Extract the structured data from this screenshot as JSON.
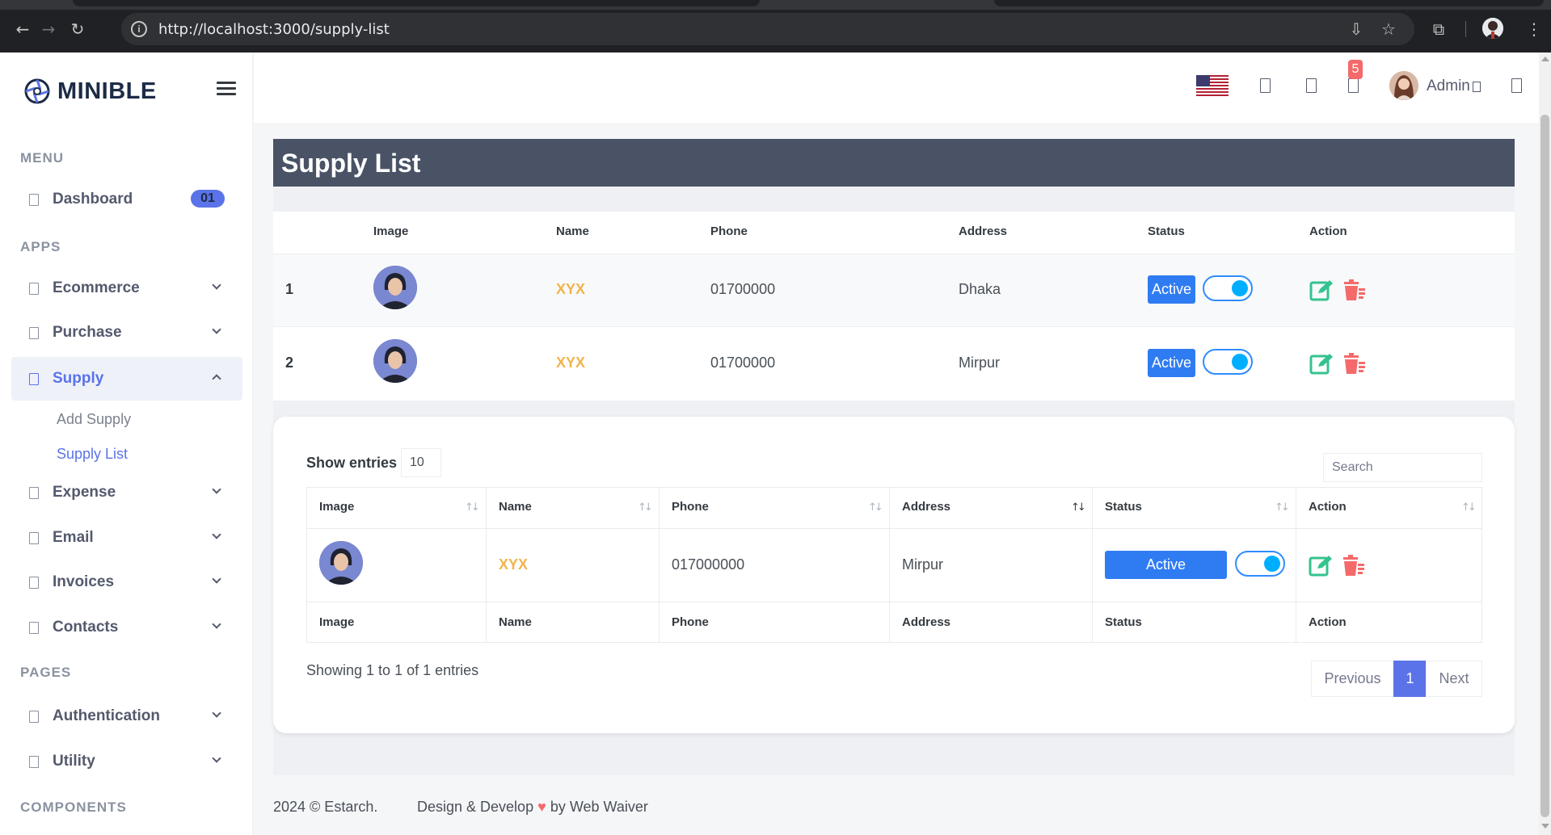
{
  "browser": {
    "url": "http://localhost:3000/supply-list"
  },
  "brand": {
    "name": "MINIBLE"
  },
  "sidebar": {
    "sections": {
      "menu": "MENU",
      "apps": "APPS",
      "pages": "PAGES",
      "components": "COMPONENTS"
    },
    "items": [
      {
        "label": "Dashboard",
        "badge": "01"
      },
      {
        "label": "Ecommerce"
      },
      {
        "label": "Purchase"
      },
      {
        "label": "Supply"
      },
      {
        "label": "Expense"
      },
      {
        "label": "Email"
      },
      {
        "label": "Invoices"
      },
      {
        "label": "Contacts"
      },
      {
        "label": "Authentication"
      },
      {
        "label": "Utility"
      }
    ],
    "submenu": [
      {
        "label": "Add Supply"
      },
      {
        "label": "Supply List"
      }
    ]
  },
  "topbar": {
    "notification_count": "5",
    "user_name": "Admin"
  },
  "page": {
    "title": "Supply List"
  },
  "table1": {
    "headers": [
      "Image",
      "Name",
      "Phone",
      "Address",
      "Status",
      "Action"
    ],
    "rows": [
      {
        "num": "1",
        "name": "XYX",
        "phone": "01700000",
        "address": "Dhaka",
        "status": "Active"
      },
      {
        "num": "2",
        "name": "XYX",
        "phone": "01700000",
        "address": "Mirpur",
        "status": "Active"
      }
    ]
  },
  "datatable": {
    "show_entries_label": "Show entries",
    "entries_value": "10",
    "search_placeholder": "Search",
    "headers": [
      "Image",
      "Name",
      "Phone",
      "Address",
      "Status",
      "Action"
    ],
    "footer_headers": [
      "Image",
      "Name",
      "Phone",
      "Address",
      "Status",
      "Action"
    ],
    "rows": [
      {
        "name": "XYX",
        "phone": "017000000",
        "address": "Mirpur",
        "status": "Active"
      }
    ],
    "showing_text": "Showing 1 to 1 of 1 entries",
    "pagination": {
      "previous": "Previous",
      "current": "1",
      "next": "Next"
    }
  },
  "footer": {
    "copyright": "2024 © Estarch.",
    "credit_prefix": "Design & Develop",
    "credit_suffix": "by Web Waiver"
  },
  "colors": {
    "primary": "#5b73e8",
    "header_bg": "#495365",
    "name_orange": "#f1b44c",
    "active_badge": "#2f7cf2",
    "edit_green": "#34c38f",
    "delete_red": "#f46a6a"
  }
}
